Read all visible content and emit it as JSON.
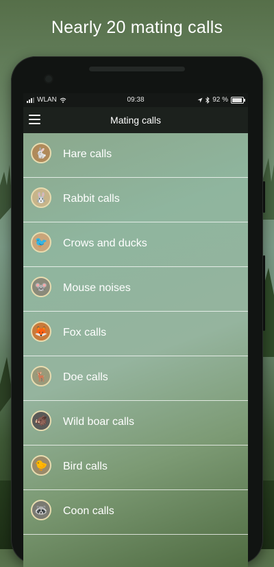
{
  "headline": "Nearly 20 mating calls",
  "statusbar": {
    "carrier": "WLAN",
    "time": "09:38",
    "battery": "92 %",
    "battery_level": 0.92
  },
  "navbar": {
    "title": "Mating calls"
  },
  "items": [
    {
      "label": "Hare calls",
      "icon": "hare-icon",
      "glyph": "🐇",
      "bg": "#b08a5a"
    },
    {
      "label": "Rabbit calls",
      "icon": "rabbit-icon",
      "glyph": "🐰",
      "bg": "#c7b48a"
    },
    {
      "label": "Crows and ducks",
      "icon": "crow-icon",
      "glyph": "🐦",
      "bg": "#c9a57a"
    },
    {
      "label": "Mouse noises",
      "icon": "mouse-icon",
      "glyph": "🐭",
      "bg": "#8a8a7a"
    },
    {
      "label": "Fox calls",
      "icon": "fox-icon",
      "glyph": "🦊",
      "bg": "#c97a3a"
    },
    {
      "label": "Doe calls",
      "icon": "doe-icon",
      "glyph": "🦌",
      "bg": "#9a9a7a"
    },
    {
      "label": "Wild boar calls",
      "icon": "boar-icon",
      "glyph": "🐗",
      "bg": "#5a5a58"
    },
    {
      "label": "Bird calls",
      "icon": "bird-icon",
      "glyph": "🐤",
      "bg": "#9a8a6a"
    },
    {
      "label": "Coon calls",
      "icon": "raccoon-icon",
      "glyph": "🦝",
      "bg": "#7a7a72"
    }
  ]
}
